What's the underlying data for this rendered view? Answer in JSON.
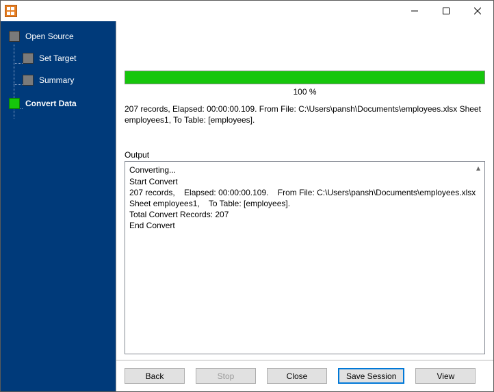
{
  "window": {
    "title": ""
  },
  "sidebar": {
    "steps": [
      {
        "label": "Open Source",
        "indent": false,
        "active": false
      },
      {
        "label": "Set Target",
        "indent": true,
        "active": false
      },
      {
        "label": "Summary",
        "indent": true,
        "active": false
      },
      {
        "label": "Convert Data",
        "indent": false,
        "active": true
      }
    ]
  },
  "progress": {
    "percent_label": "100 %"
  },
  "status": {
    "text": "207 records,    Elapsed: 00:00:00.109.    From File: C:\\Users\\pansh\\Documents\\employees.xlsx Sheet employees1,    To Table: [employees]."
  },
  "output": {
    "label": "Output",
    "text": "Converting...\nStart Convert\n207 records,    Elapsed: 00:00:00.109.    From File: C:\\Users\\pansh\\Documents\\employees.xlsx Sheet employees1,    To Table: [employees].\nTotal Convert Records: 207\nEnd Convert"
  },
  "buttons": {
    "back": "Back",
    "stop": "Stop",
    "close": "Close",
    "save_session": "Save Session",
    "view": "View"
  }
}
